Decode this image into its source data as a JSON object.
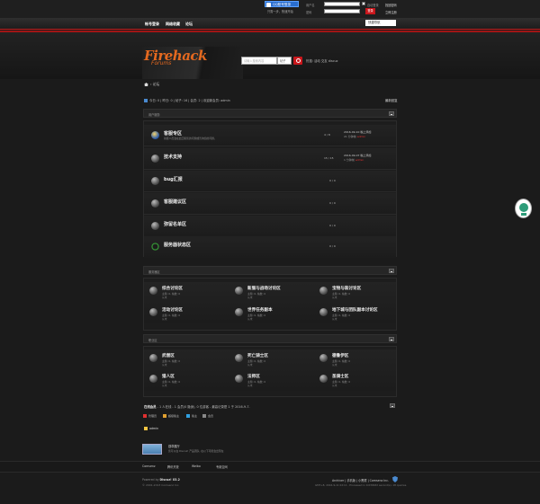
{
  "topbar": {
    "qq_login": "QQ账号登录",
    "qq_sub": "只需一步，快速开始",
    "username_label": "用户名",
    "password_label": "密码",
    "remember_label": "自动登录",
    "find_password": "找回密码",
    "register": "立即注册",
    "login_button": "登录"
  },
  "nav": {
    "items": [
      "帐号登录",
      "网络收藏",
      "论坛"
    ],
    "quick_nav": "快捷导航"
  },
  "logo": {
    "text": "Firehack",
    "sub": "Forums"
  },
  "search": {
    "placeholder": "请输入搜索内容",
    "type": "帖子",
    "hot_label": "热搜:",
    "hot_items": "活动  交友  discuz"
  },
  "breadcrumb": {
    "text": "›  论坛"
  },
  "stats": {
    "text": "今日: 0 | 昨日: 0 | 帖子: 16 | 会员: 2 | 欢迎新会员: admin",
    "right": "最新回复"
  },
  "sections": [
    {
      "title": "用户服务",
      "forums": [
        {
          "name": "客服专区",
          "desc": "客服人员会在此回答您的问题或咨询您的问题。",
          "count": "4 / 8",
          "last1": "2016-09-10 晚上添加",
          "last2": "21 分钟前",
          "last_user": "admin"
        },
        {
          "name": "技术支持",
          "desc": "",
          "count": "15 / 15",
          "last1": "2016-09-07 晚上添加",
          "last2": "1 分钟前",
          "last_user": "admin"
        },
        {
          "name": "bug汇报",
          "desc": "",
          "count": "0 / 0",
          "last1": "",
          "last2": "",
          "last_user": ""
        },
        {
          "name": "客服建议区",
          "desc": "",
          "count": "0 / 0",
          "last1": "",
          "last2": "",
          "last_user": ""
        },
        {
          "name": "弥留名单区",
          "desc": "",
          "count": "0 / 0",
          "last1": "",
          "last2": "",
          "last_user": ""
        },
        {
          "name": "服务器状态区",
          "desc": "",
          "count": "0 / 0",
          "last1": "",
          "last2": "",
          "last_user": ""
        }
      ]
    },
    {
      "title": "服务器区",
      "forums": [
        {
          "name": "综合讨论区",
          "meta": "主题: 0, 帖数: 0",
          "meta2": "从未"
        },
        {
          "name": "新服与战场讨论区",
          "meta": "主题: 0, 帖数: 0",
          "meta2": "从未"
        },
        {
          "name": "宝物与装讨论区",
          "meta": "主题: 0, 帖数: 0",
          "meta2": "从未"
        },
        {
          "name": "活动讨论区",
          "meta": "主题: 0, 帖数: 0",
          "meta2": "从未"
        },
        {
          "name": "世界任务副本",
          "meta": "主题: 0, 帖数: 0",
          "meta2": "从未"
        },
        {
          "name": "地下城与团队副本讨论区",
          "meta": "主题: 0, 帖数: 0",
          "meta2": "从未"
        }
      ]
    },
    {
      "title": "职业区",
      "forums": [
        {
          "name": "武僧区",
          "meta": "主题: 0, 帖数: 0",
          "meta2": "从未"
        },
        {
          "name": "死亡骑士区",
          "meta": "主题: 0, 帖数: 0",
          "meta2": "从未"
        },
        {
          "name": "德鲁伊区",
          "meta": "主题: 0, 帖数: 0",
          "meta2": "从未"
        },
        {
          "name": "猎人区",
          "meta": "主题: 0, 帖数: 0",
          "meta2": "从未"
        },
        {
          "name": "法师区",
          "meta": "主题: 0, 帖数: 0",
          "meta2": "从未"
        },
        {
          "name": "圣骑士区",
          "meta": "主题: 0, 帖数: 0",
          "meta2": "从未"
        }
      ]
    }
  ],
  "online": {
    "title": "在线会员",
    "text": " - 1 人在线 - 1 会员(0 隐身), 0 位游客 - 最高记录是 1 于 2016-9-7.",
    "legend": [
      "管理员",
      "超级版主",
      "版主",
      "会员"
    ],
    "legend_colors": [
      "#e03030",
      "#e0a030",
      "#30a0e0",
      "#888888"
    ],
    "user": "admin"
  },
  "badge": {
    "title": "勋章展厅",
    "desc": "您可以在 Discuz! 产品团队, 在以下可能会出现在"
  },
  "footer": {
    "links": [
      "Comsenz",
      "腾讯开放",
      "Weibo",
      "专用空间"
    ],
    "powered": "Powered by",
    "powered_brand": "Discuz! X3.2",
    "copyright": "© 2001-2013 Comsenz Inc.",
    "right_links": "Archiver | 手机版 | 小黑屋 | Comsenz Inc.",
    "time": "GMT+8, 2016-9-11 02:11 , Processed in 0.036632 second(s), 18 queries."
  }
}
